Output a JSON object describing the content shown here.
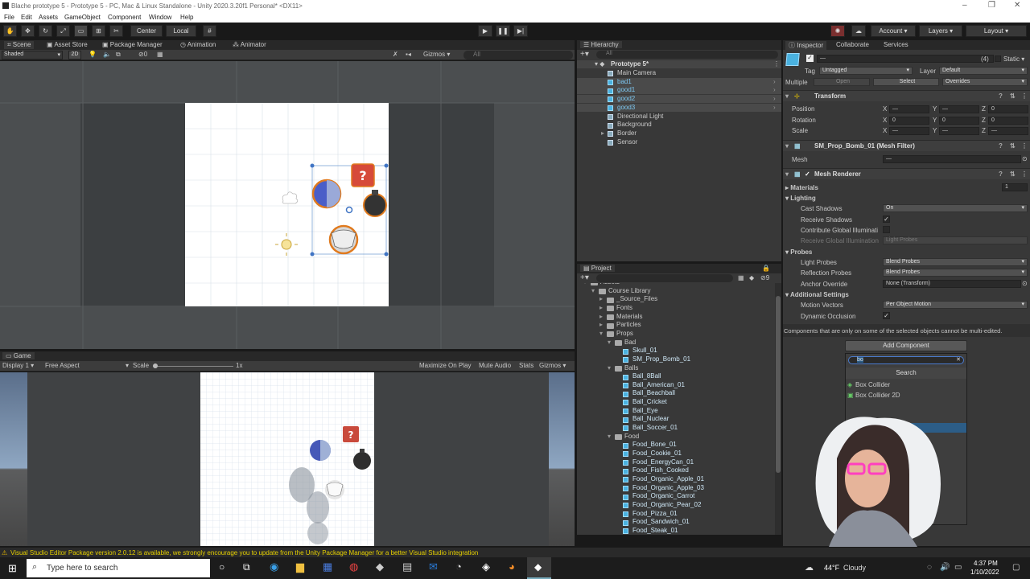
{
  "window": {
    "title": "Blache prototype 5 - Prototype 5 - PC, Mac & Linux Standalone - Unity 2020.3.20f1 Personal* <DX11>"
  },
  "menu": [
    "File",
    "Edit",
    "Assets",
    "GameObject",
    "Component",
    "Window",
    "Help"
  ],
  "toolbar": {
    "center": "Center",
    "local": "Local",
    "account": "Account",
    "layers": "Layers",
    "layout": "Layout"
  },
  "scene_tabs": [
    "Scene",
    "Asset Store",
    "Package Manager",
    "Animation",
    "Animator"
  ],
  "scene_toolbar": {
    "shading": "Shaded",
    "mode": "2D",
    "hidden": "0",
    "gizmos": "Gizmos",
    "search_placeholder": "All"
  },
  "game": {
    "tab": "Game",
    "display": "Display 1",
    "aspect": "Free Aspect",
    "scale_label": "Scale",
    "scale_value": "1x",
    "buttons": [
      "Maximize On Play",
      "Mute Audio",
      "Stats",
      "Gizmos"
    ]
  },
  "hierarchy": {
    "tab": "Hierarchy",
    "search_placeholder": "All",
    "scene": "Prototype 5*",
    "items": [
      {
        "label": "Main Camera",
        "prefab": false,
        "selected": false,
        "expander": false
      },
      {
        "label": "bad1",
        "prefab": true,
        "selected": true,
        "expander": false
      },
      {
        "label": "good1",
        "prefab": true,
        "selected": true,
        "expander": false
      },
      {
        "label": "good2",
        "prefab": true,
        "selected": true,
        "expander": false
      },
      {
        "label": "good3",
        "prefab": true,
        "selected": true,
        "expander": false
      },
      {
        "label": "Directional Light",
        "prefab": false,
        "selected": false,
        "expander": false
      },
      {
        "label": "Background",
        "prefab": false,
        "selected": false,
        "expander": false
      },
      {
        "label": "Border",
        "prefab": false,
        "selected": false,
        "expander": true
      },
      {
        "label": "Sensor",
        "prefab": false,
        "selected": false,
        "expander": false
      }
    ]
  },
  "project": {
    "tab": "Project",
    "count": "9",
    "tree": [
      {
        "label": "Assets",
        "depth": 0,
        "type": "folder"
      },
      {
        "label": "Course Library",
        "depth": 1,
        "type": "folder"
      },
      {
        "label": "_Source_Files",
        "depth": 2,
        "type": "folder"
      },
      {
        "label": "Fonts",
        "depth": 2,
        "type": "folder"
      },
      {
        "label": "Materials",
        "depth": 2,
        "type": "folder"
      },
      {
        "label": "Particles",
        "depth": 2,
        "type": "folder"
      },
      {
        "label": "Props",
        "depth": 2,
        "type": "folder"
      },
      {
        "label": "Bad",
        "depth": 3,
        "type": "folder"
      },
      {
        "label": "Skull_01",
        "depth": 4,
        "type": "prefab"
      },
      {
        "label": "SM_Prop_Bomb_01",
        "depth": 4,
        "type": "prefab"
      },
      {
        "label": "Balls",
        "depth": 3,
        "type": "folder"
      },
      {
        "label": "Ball_8Ball",
        "depth": 4,
        "type": "prefab"
      },
      {
        "label": "Ball_American_01",
        "depth": 4,
        "type": "prefab"
      },
      {
        "label": "Ball_Beachball",
        "depth": 4,
        "type": "prefab"
      },
      {
        "label": "Ball_Cricket",
        "depth": 4,
        "type": "prefab"
      },
      {
        "label": "Ball_Eye",
        "depth": 4,
        "type": "prefab"
      },
      {
        "label": "Ball_Nuclear",
        "depth": 4,
        "type": "prefab"
      },
      {
        "label": "Ball_Soccer_01",
        "depth": 4,
        "type": "prefab"
      },
      {
        "label": "Food",
        "depth": 3,
        "type": "folder"
      },
      {
        "label": "Food_Bone_01",
        "depth": 4,
        "type": "prefab"
      },
      {
        "label": "Food_Cookie_01",
        "depth": 4,
        "type": "prefab"
      },
      {
        "label": "Food_EnergyCan_01",
        "depth": 4,
        "type": "prefab"
      },
      {
        "label": "Food_Fish_Cooked",
        "depth": 4,
        "type": "prefab"
      },
      {
        "label": "Food_Organic_Apple_01",
        "depth": 4,
        "type": "prefab"
      },
      {
        "label": "Food_Organic_Apple_03",
        "depth": 4,
        "type": "prefab"
      },
      {
        "label": "Food_Organic_Carrot",
        "depth": 4,
        "type": "prefab"
      },
      {
        "label": "Food_Organic_Pear_02",
        "depth": 4,
        "type": "prefab"
      },
      {
        "label": "Food_Pizza_01",
        "depth": 4,
        "type": "prefab"
      },
      {
        "label": "Food_Sandwich_01",
        "depth": 4,
        "type": "prefab"
      },
      {
        "label": "Food_Steak_01",
        "depth": 4,
        "type": "prefab"
      }
    ]
  },
  "inspector": {
    "tabs": [
      "Inspector",
      "Collaborate",
      "Services"
    ],
    "object_name": "—",
    "object_count": "(4)",
    "static": "Static",
    "tag_label": "Tag",
    "tag_value": "Untagged",
    "layer_label": "Layer",
    "layer_value": "Default",
    "multiple": "Multiple",
    "open": "Open",
    "select": "Select",
    "overrides": "Overrides",
    "transform": {
      "title": "Transform",
      "position": {
        "label": "Position",
        "x": "—",
        "y": "—",
        "z": "0"
      },
      "rotation": {
        "label": "Rotation",
        "x": "0",
        "y": "0",
        "z": "0"
      },
      "scale": {
        "label": "Scale",
        "x": "—",
        "y": "—",
        "z": "—"
      }
    },
    "mesh_filter": {
      "title": "SM_Prop_Bomb_01 (Mesh Filter)",
      "mesh_label": "Mesh",
      "mesh_value": "—"
    },
    "mesh_renderer": {
      "title": "Mesh Renderer",
      "materials": "Materials",
      "materials_count": "1",
      "lighting": "Lighting",
      "cast_shadows": "Cast Shadows",
      "cast_shadows_value": "On",
      "receive_shadows": "Receive Shadows",
      "contribute_gi": "Contribute Global Illuminati",
      "receive_gi": "Receive Global Illumination",
      "receive_gi_value": "Light Probes",
      "probes": "Probes",
      "light_probes": "Light Probes",
      "light_probes_value": "Blend Probes",
      "reflection_probes": "Reflection Probes",
      "reflection_probes_value": "Blend Probes",
      "anchor_override": "Anchor Override",
      "anchor_override_value": "None (Transform)",
      "additional": "Additional Settings",
      "motion_vectors": "Motion Vectors",
      "motion_vectors_value": "Per Object Motion",
      "dynamic_occlusion": "Dynamic Occlusion"
    },
    "note": "Components that are only on some of the selected objects cannot be multi-edited.",
    "add_component": "Add Component",
    "search_value": "bo",
    "search_header": "Search",
    "results": [
      "Box Collider",
      "Box Collider 2D"
    ]
  },
  "status": {
    "message": "Visual Studio Editor Package version 2.0.12 is available, we strongly encourage you to update from the Unity Package Manager for a better Visual Studio integration"
  },
  "taskbar": {
    "search_placeholder": "Type here to search",
    "weather_temp": "44°F",
    "weather_desc": "Cloudy",
    "time": "4:37 PM",
    "date": "1/10/2022"
  },
  "colors": {
    "accent_select": "#2c5d87",
    "prefab_blue": "#4ab2e0",
    "warning": "#e6b800"
  }
}
